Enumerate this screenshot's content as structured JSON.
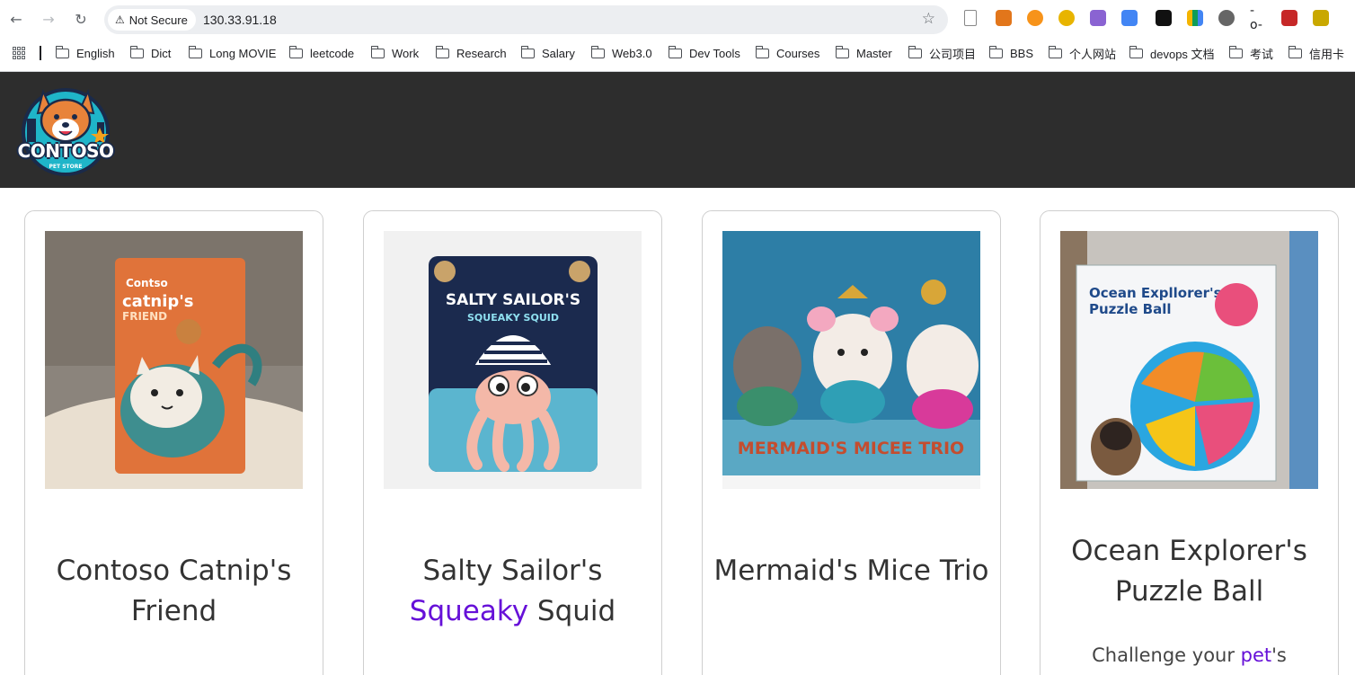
{
  "browser": {
    "security_label": "Not Secure",
    "url": "130.33.91.18",
    "bookmarks": [
      "English",
      "Dict",
      "Long MOVIE",
      "leetcode",
      "Work",
      "Research",
      "Salary",
      "Web3.0",
      "Dev Tools",
      "Courses",
      "Master",
      "公司项目",
      "BBS",
      "个人网站",
      "devops 文档",
      "考试",
      "信用卡"
    ]
  },
  "header": {
    "background": "#2d2d2d",
    "logo_text": "CONTOSO",
    "logo_sub": "PET STORE"
  },
  "products": [
    {
      "title_pre": "Contoso Catnip's Friend",
      "title_hl": "",
      "title_post": "",
      "desc_pre": "",
      "desc_hl": "",
      "desc_post": ""
    },
    {
      "title_pre": "Salty Sailor's ",
      "title_hl": "Squeaky",
      "title_post": " Squid",
      "desc_pre": "",
      "desc_hl": "",
      "desc_post": ""
    },
    {
      "title_pre": "Mermaid's Mice Trio",
      "title_hl": "",
      "title_post": "",
      "desc_pre": "",
      "desc_hl": "",
      "desc_post": ""
    },
    {
      "title_pre": "Ocean Explorer's Puzzle Ball",
      "title_hl": "",
      "title_post": "",
      "desc_pre": "Challenge your ",
      "desc_hl": "pet",
      "desc_post": "'s"
    }
  ],
  "images": [
    {
      "package_brand": "Contso",
      "package_line1": "catnip's",
      "package_line2": "FRIEND"
    },
    {
      "package_line1": "SALTY SAILOR'S",
      "package_line2": "SQUEAKY SQUID"
    },
    {
      "package_line1": "MERMAID'S MICEE TRIO"
    },
    {
      "package_line1": "Ocean Expllorer's",
      "package_line2": "Puzzle Ball"
    }
  ],
  "colors": {
    "accent": "#6610d8",
    "title": "#333333"
  }
}
